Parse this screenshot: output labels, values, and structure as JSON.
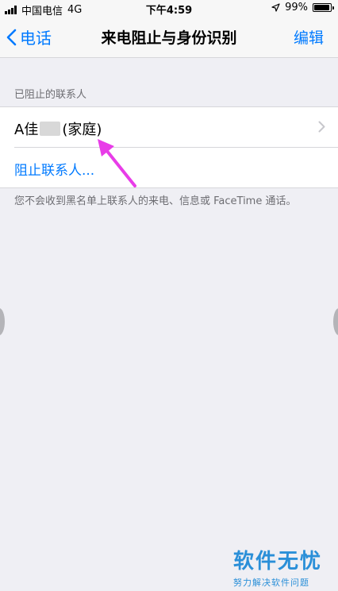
{
  "status_bar": {
    "carrier": "中国电信",
    "network": "4G",
    "time": "下午4:59",
    "battery": "99%"
  },
  "nav": {
    "back_label": "电话",
    "title": "来电阻止与身份识别",
    "edit_label": "编辑"
  },
  "blocked_section": {
    "header": "已阻止的联系人",
    "contact_prefix": "A佳",
    "contact_suffix": "(家庭)",
    "block_contact_label": "阻止联系人..."
  },
  "footer_note": "您不会收到黑名单上联系人的来电、信息或 FaceTime 通话。",
  "watermark": {
    "title": "软件无忧",
    "subtitle": "努力解决软件问题"
  },
  "colors": {
    "accent": "#007aff",
    "annotation_arrow": "#e83ce8",
    "background": "#efeff4"
  }
}
